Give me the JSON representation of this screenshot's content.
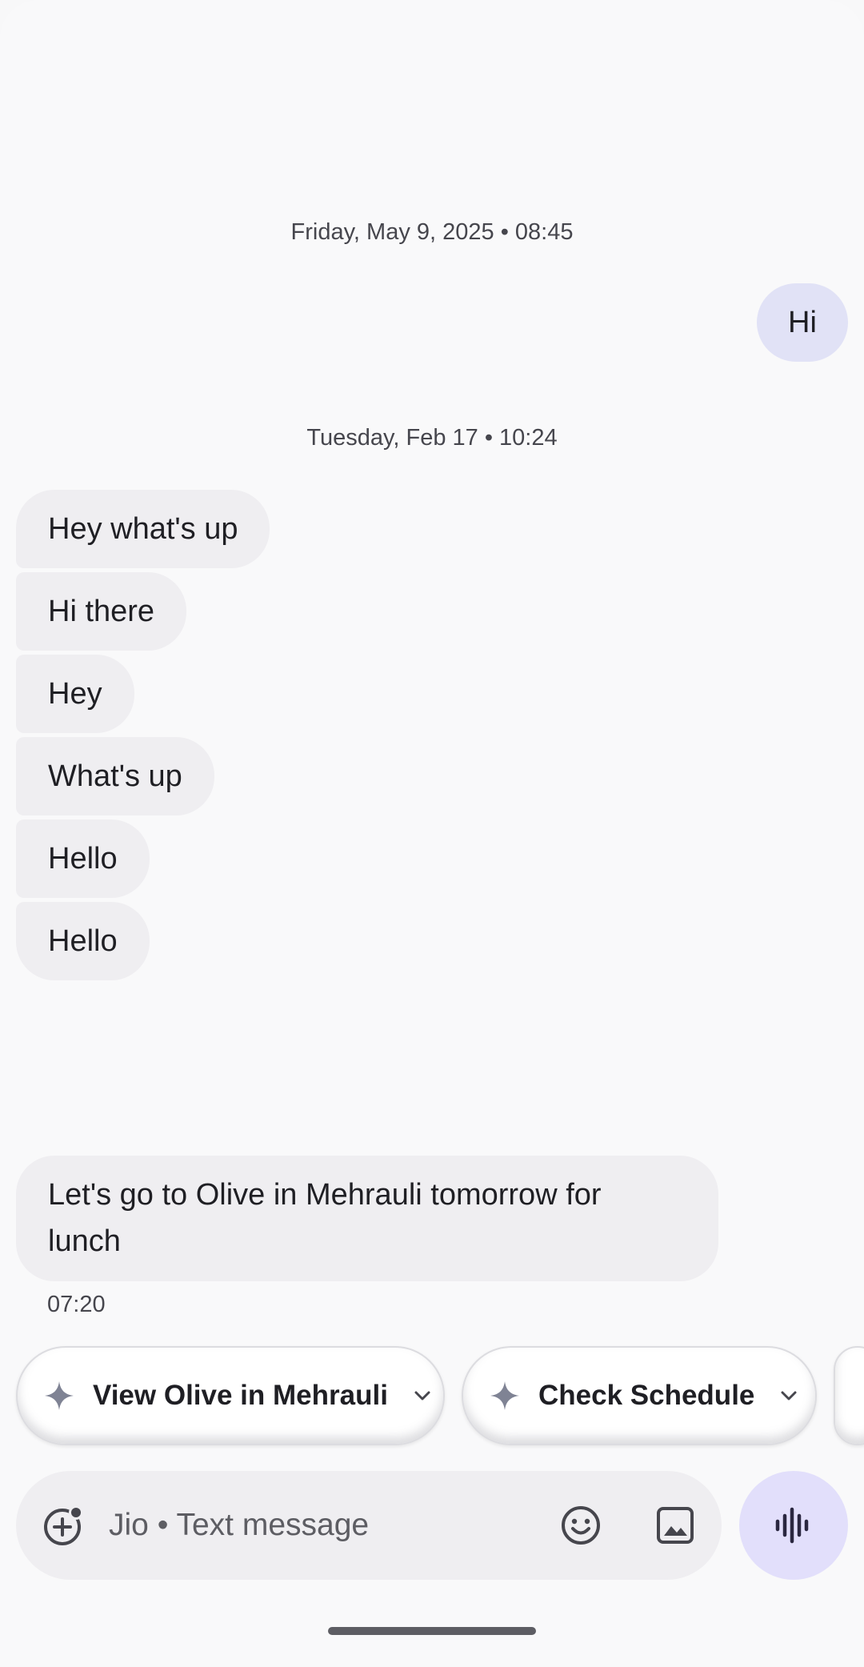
{
  "conversation": {
    "timestamps": [
      "Friday, May 9, 2025 • 08:45",
      "Tuesday, Feb 17 • 10:24"
    ],
    "outgoing": [
      {
        "text": "Hi"
      }
    ],
    "incoming_group": [
      {
        "text": "Hey what's up"
      },
      {
        "text": "Hi there"
      },
      {
        "text": "Hey"
      },
      {
        "text": "What's up"
      },
      {
        "text": "Hello"
      },
      {
        "text": "Hello"
      }
    ],
    "last_message": {
      "line1": "Let's go to Olive in Mehrauli tomorrow for",
      "line2": "lunch",
      "time": "07:20"
    }
  },
  "suggestions": [
    {
      "label": "View Olive in Mehrauli",
      "icon": "sparkle-icon"
    },
    {
      "label": "Check Schedule",
      "icon": "sparkle-icon"
    }
  ],
  "compose": {
    "placeholder": "Jio • Text message",
    "icons": [
      "add-attachment-icon",
      "emoji-icon",
      "gallery-icon",
      "voice-waveform-icon"
    ]
  },
  "colors": {
    "outgoing_bubble": "#e1e2f6",
    "incoming_bubble": "#efeef1",
    "voice_button": "#e2dffb",
    "background": "#f9f9fa"
  }
}
